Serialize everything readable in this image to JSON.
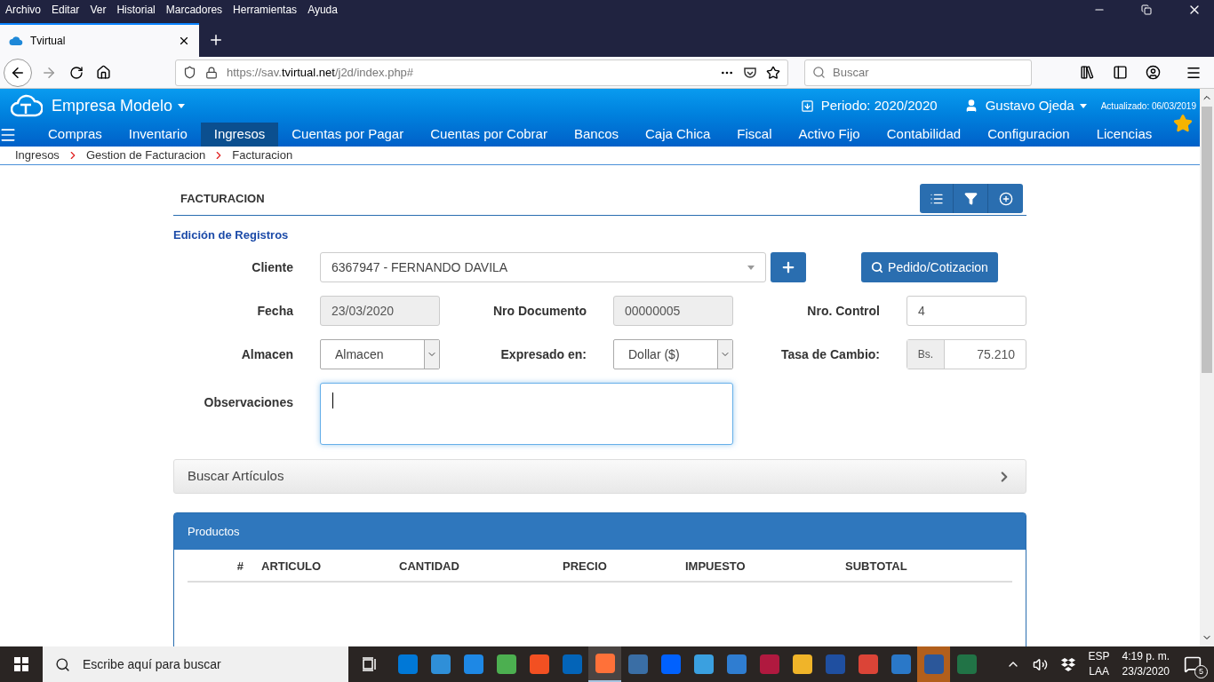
{
  "browser": {
    "menu": [
      "Archivo",
      "Editar",
      "Ver",
      "Historial",
      "Marcadores",
      "Herramientas",
      "Ayuda"
    ],
    "tab": {
      "title": "Tvirtual"
    },
    "url": {
      "prefix": "https://sav.",
      "host": "tvirtual.net",
      "path": "/j2d/index.php#"
    },
    "search": {
      "placeholder": "Buscar"
    }
  },
  "app": {
    "company": "Empresa Modelo",
    "period": "Periodo: 2020/2020",
    "user": "Gustavo Ojeda",
    "updated": "Actualizado: 06/03/2019",
    "nav": [
      {
        "label": "Compras",
        "selected": false
      },
      {
        "label": "Inventario",
        "selected": false
      },
      {
        "label": "Ingresos",
        "selected": true
      },
      {
        "label": "Cuentas por Pagar",
        "selected": false
      },
      {
        "label": "Cuentas por Cobrar",
        "selected": false
      },
      {
        "label": "Bancos",
        "selected": false
      },
      {
        "label": "Caja Chica",
        "selected": false
      },
      {
        "label": "Fiscal",
        "selected": false
      },
      {
        "label": "Activo Fijo",
        "selected": false
      },
      {
        "label": "Contabilidad",
        "selected": false
      },
      {
        "label": "Configuracion",
        "selected": false
      },
      {
        "label": "Licencias",
        "selected": false
      }
    ],
    "breadcrumb": [
      "Ingresos",
      "Gestion de Facturacion",
      "Facturacion"
    ]
  },
  "form": {
    "title": "FACTURACION",
    "subtitle": "Edición de Registros",
    "cliente": {
      "label": "Cliente",
      "value": "6367947 - FERNANDO DAVILA"
    },
    "quote_button": "Pedido/Cotizacion",
    "fecha": {
      "label": "Fecha",
      "value": "23/03/2020",
      "disabled": true
    },
    "documento": {
      "label": "Nro Documento",
      "value": "00000005",
      "disabled": true
    },
    "control": {
      "label": "Nro. Control",
      "value": "4",
      "disabled": false
    },
    "almacen": {
      "label": "Almacen",
      "value": "Almacen"
    },
    "expresado": {
      "label": "Expresado en:",
      "value": "Dollar ($)"
    },
    "tasa": {
      "label": "Tasa de Cambio:",
      "addon": "Bs.",
      "value": "75.210"
    },
    "observaciones": {
      "label": "Observaciones",
      "focused": true
    }
  },
  "search_panel": {
    "title": "Buscar Artículos",
    "expanded": false
  },
  "products": {
    "title": "Productos",
    "columns": [
      "#",
      "ARTICULO",
      "CANTIDAD",
      "PRECIO",
      "IMPUESTO",
      "SUBTOTAL"
    ]
  },
  "taskbar": {
    "search_placeholder": "Escribe aquí para buscar",
    "apps": [
      {
        "color": "#0078d7",
        "selected": false,
        "attention": false
      },
      {
        "color": "#2f8fd8",
        "selected": false,
        "attention": false
      },
      {
        "color": "#1e88e5",
        "selected": false,
        "attention": false
      },
      {
        "color": "#4caf50",
        "selected": false,
        "attention": false
      },
      {
        "color": "#f25022",
        "selected": false,
        "attention": false
      },
      {
        "color": "#0364b8",
        "selected": false,
        "attention": false
      },
      {
        "color": "#ff7139",
        "selected": true,
        "attention": false
      },
      {
        "color": "#3a6ea5",
        "selected": false,
        "attention": false
      },
      {
        "color": "#0061fe",
        "selected": false,
        "attention": false
      },
      {
        "color": "#3aa0e0",
        "selected": false,
        "attention": false
      },
      {
        "color": "#2f7dd1",
        "selected": false,
        "attention": false
      },
      {
        "color": "#b0193f",
        "selected": false,
        "attention": false
      },
      {
        "color": "#f0b429",
        "selected": false,
        "attention": false
      },
      {
        "color": "#1f4fa0",
        "selected": false,
        "attention": false
      },
      {
        "color": "#db4437",
        "selected": false,
        "attention": false
      },
      {
        "color": "#2a78c8",
        "selected": false,
        "attention": false
      },
      {
        "color": "#2b579a",
        "selected": false,
        "attention": true
      },
      {
        "color": "#217346",
        "selected": false,
        "attention": false
      }
    ],
    "language": [
      "ESP",
      "LAA"
    ],
    "time": "4:19 p. m.",
    "date": "23/3/2020",
    "notifications": "5"
  }
}
